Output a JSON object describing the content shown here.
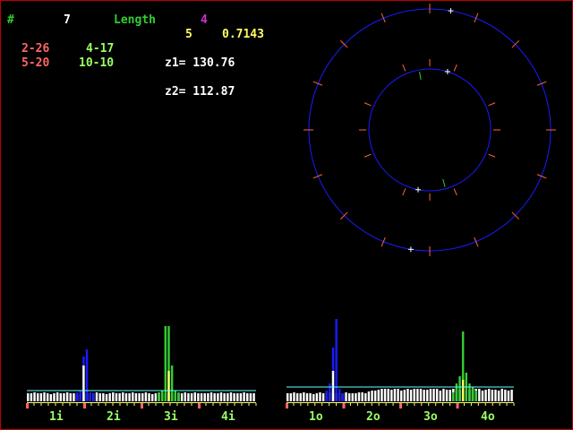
{
  "colors": {
    "green": "#33cc33",
    "white": "#ffffff",
    "magenta": "#cc33cc",
    "yellow": "#ffff66",
    "red": "#ff6666",
    "lightgreen": "#99ff66",
    "blue": "#1a1aff",
    "cyan": "#66ffff",
    "tick": "#ff6633",
    "marker": "#ff6666"
  },
  "header": {
    "hash": "#",
    "count": "7",
    "length_label": "Length",
    "length_value": "4",
    "ratio_index": "5",
    "ratio_value": "0.7143"
  },
  "pairs": {
    "p1_left": "2-26",
    "p1_right": "4-17",
    "p2_left": "5-20",
    "p2_right": "10-10"
  },
  "z": {
    "z1": "z1= 130.76",
    "z2": "z2= 112.87"
  },
  "rings": {
    "outer_plus_angles_deg": [
      -80,
      99
    ],
    "inner_plus_angles_deg": [
      -73,
      101
    ],
    "green_tick_angles_deg": [
      -100,
      75
    ]
  },
  "charts": {
    "left": {
      "labels": [
        "1i",
        "2i",
        "3i",
        "4i"
      ],
      "baseline_heights": [
        9,
        9,
        10,
        9,
        9,
        10,
        9,
        8,
        9,
        10,
        9,
        9,
        10,
        9,
        9,
        8,
        9,
        10,
        9,
        9,
        9,
        10,
        9,
        9,
        8,
        9,
        10,
        9,
        9,
        10,
        9,
        9,
        10,
        9,
        9,
        9,
        10,
        9,
        8,
        9,
        10,
        9,
        9,
        9,
        9,
        10,
        9,
        9,
        10,
        9,
        9,
        10,
        9,
        9,
        9,
        9,
        10,
        9,
        9,
        10,
        9,
        9,
        10,
        9,
        9,
        9,
        10,
        9,
        9,
        9
      ],
      "blue_spikes": [
        [
          15,
          10
        ],
        [
          16,
          12
        ],
        [
          17,
          50
        ],
        [
          18,
          58
        ],
        [
          19,
          10
        ],
        [
          20,
          9
        ]
      ],
      "white_spikes": [
        [
          17,
          40
        ]
      ],
      "green_spikes": [
        [
          40,
          10
        ],
        [
          41,
          12
        ],
        [
          42,
          84
        ],
        [
          43,
          84
        ],
        [
          44,
          40
        ],
        [
          45,
          12
        ],
        [
          46,
          10
        ]
      ],
      "yellow_spikes": [
        [
          43,
          34
        ]
      ]
    },
    "right": {
      "labels": [
        "1o",
        "2o",
        "3o",
        "4o"
      ],
      "baseline_heights": [
        9,
        9,
        10,
        9,
        9,
        10,
        9,
        9,
        8,
        9,
        10,
        9,
        9,
        10,
        9,
        9,
        10,
        9,
        10,
        9,
        9,
        9,
        10,
        10,
        9,
        11,
        12,
        12,
        13,
        14,
        14,
        14,
        13,
        14,
        14,
        12,
        13,
        14,
        13,
        14,
        14,
        14,
        13,
        13,
        14,
        14,
        14,
        12,
        14,
        13,
        13,
        14,
        14,
        13,
        12,
        12,
        13,
        14,
        14,
        14,
        12,
        13,
        14,
        13,
        13,
        12,
        14,
        13,
        12,
        13
      ],
      "blue_spikes": [
        [
          12,
          12
        ],
        [
          13,
          20
        ],
        [
          14,
          60
        ],
        [
          15,
          92
        ],
        [
          16,
          14
        ],
        [
          17,
          9
        ]
      ],
      "white_spikes": [
        [
          14,
          34
        ]
      ],
      "green_spikes": [
        [
          51,
          10
        ],
        [
          52,
          20
        ],
        [
          53,
          28
        ],
        [
          54,
          78
        ],
        [
          55,
          32
        ],
        [
          56,
          20
        ],
        [
          57,
          16
        ],
        [
          58,
          12
        ]
      ],
      "yellow_spikes": [
        [
          54,
          24
        ]
      ]
    }
  }
}
